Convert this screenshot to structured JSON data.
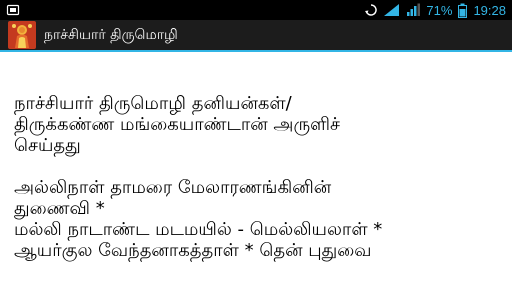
{
  "status_bar": {
    "battery_percent": "71%",
    "time": "19:28",
    "icons": [
      "screenshot-icon",
      "sync-icon",
      "wifi-icon",
      "signal-icon",
      "battery-icon"
    ]
  },
  "app": {
    "title": "நாச்சியார் திருமொழி",
    "icon": "deity-app-icon"
  },
  "content": {
    "lines": [
      "நாச்சியார் திருமொழி தனியன்கள்/",
      "திருக்கண்ண மங்கையாண்டான் அருளிச்",
      "செய்தது",
      "",
      "அல்லிநாள் தாமரை மேலாரணங்கினின்",
      "துணைவி *",
      "மல்லி நாடாண்ட மடமயில் - மெல்லியலாள் *",
      "ஆயர்குல வேந்தனாகத்தாள் * தென் புதுவை"
    ]
  },
  "colors": {
    "accent": "#33b5e5",
    "action_bar": "#1c1c1c",
    "status_bar": "#000000"
  }
}
